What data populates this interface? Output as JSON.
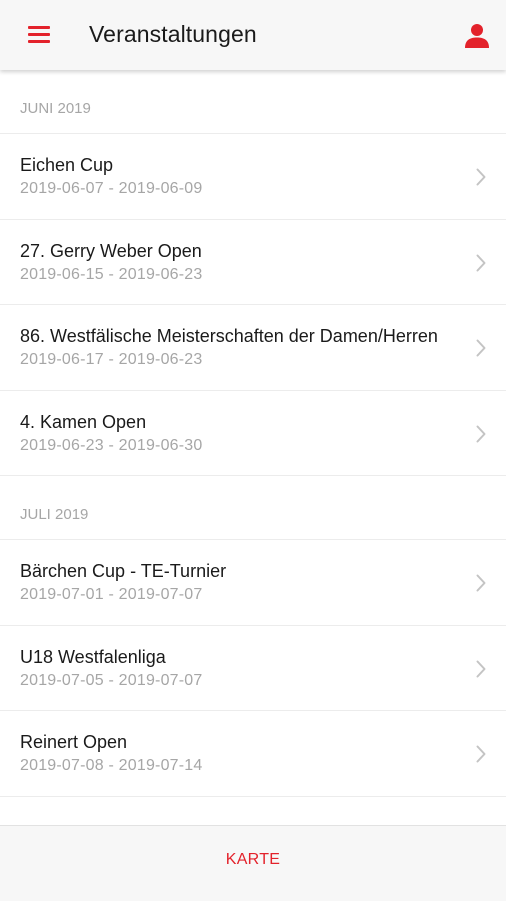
{
  "header": {
    "title": "Veranstaltungen",
    "menu_icon": "hamburger-menu-icon",
    "profile_icon": "person-icon",
    "accent_color": "#e3222b"
  },
  "sections": [
    {
      "label": "JUNI 2019",
      "events": [
        {
          "name": "Eichen Cup",
          "dates": "2019-06-07 - 2019-06-09"
        },
        {
          "name": "27. Gerry Weber Open",
          "dates": "2019-06-15 - 2019-06-23"
        },
        {
          "name": "86. Westfälische Meisterschaften der Damen/Herren",
          "dates": "2019-06-17 - 2019-06-23"
        },
        {
          "name": "4. Kamen Open",
          "dates": "2019-06-23 - 2019-06-30"
        }
      ]
    },
    {
      "label": "JULI 2019",
      "events": [
        {
          "name": "Bärchen Cup - TE-Turnier",
          "dates": "2019-07-01 - 2019-07-07"
        },
        {
          "name": "U18 Westfalenliga",
          "dates": "2019-07-05 - 2019-07-07"
        },
        {
          "name": "Reinert Open",
          "dates": "2019-07-08 - 2019-07-14"
        }
      ]
    }
  ],
  "bottom_bar": {
    "map_label": "KARTE"
  }
}
